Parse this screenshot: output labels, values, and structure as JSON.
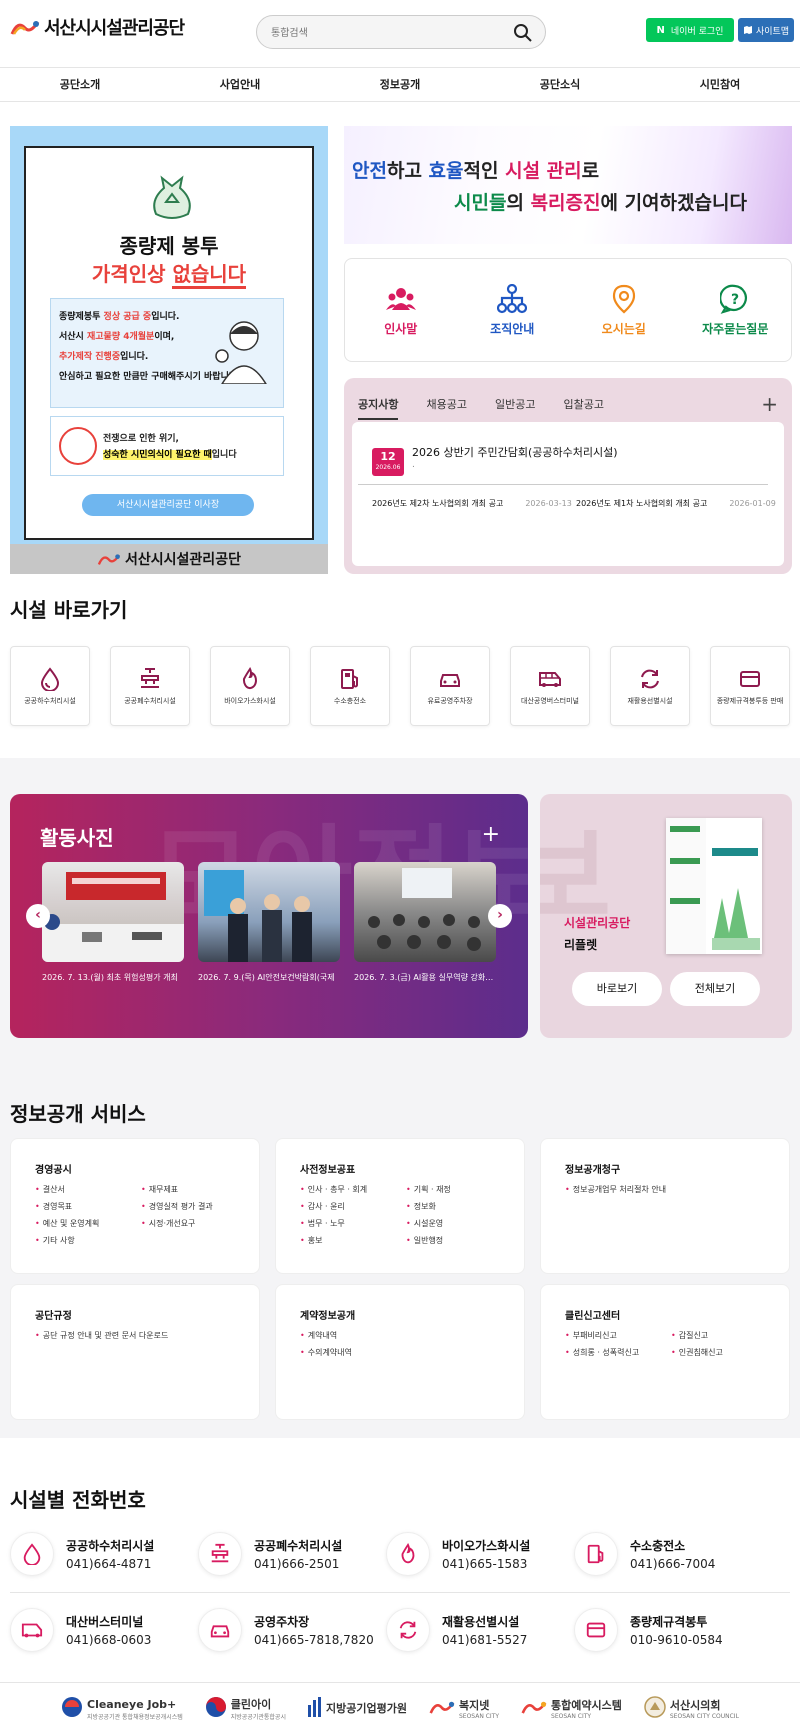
{
  "header": {
    "logo_text": "서산시시설관리공단",
    "search_placeholder": "통합검색",
    "naver_login": "네이버 로그인",
    "naver_n": "N",
    "sitemap": "사이트맵"
  },
  "gnb": [
    "공단소개",
    "사업안내",
    "정보공개",
    "공단소식",
    "시민참여"
  ],
  "poster": {
    "title": "종량제 봉투",
    "subtitle_a": "가격인상 ",
    "subtitle_b": "없습니다",
    "line1_a": "종량제봉투 ",
    "line1_b": "정상 공급 중",
    "line1_c": "입니다.",
    "line2_a": "서산시 ",
    "line2_b": "재고물량 4개월분",
    "line2_c": "이며,",
    "line3_a": "추가제작 진행중",
    "line3_b": "입니다.",
    "line4": "안심하고 필요한 만큼만 구매해주시기 바랍니다.",
    "quote1": "전쟁으로 인한 위기,",
    "quote2_a": "성숙한 시민의식이 필요한 때",
    "quote2_b": "입니다",
    "signature": "서산시시설관리공단 이사장",
    "footer_logo": "서산시시설관리공단"
  },
  "slogan": {
    "w1": "안전",
    "w2": "하고 ",
    "w3": "효율",
    "w4": "적인 ",
    "w5": "시설 관리",
    "w6": "로",
    "w7": "시민들",
    "w8": "의 ",
    "w9": "복리증진",
    "w10": "에 기여하겠습니다"
  },
  "quick_menu": [
    {
      "label": "인사말",
      "icon": "people-icon",
      "color": "#d81b60"
    },
    {
      "label": "조직안내",
      "icon": "org-chart-icon",
      "color": "#1f57c3"
    },
    {
      "label": "오시는길",
      "icon": "location-pin-icon",
      "color": "#f08a1c"
    },
    {
      "label": "자주묻는질문",
      "icon": "question-icon",
      "color": "#0c8a4a"
    }
  ],
  "notice": {
    "tabs": [
      "공지사항",
      "채용공고",
      "일반공고",
      "입찰공고"
    ],
    "plus": "+",
    "featured": {
      "day": "12",
      "date": "2026.06",
      "title": "2026 상반기 주민간담회(공공하수처리시설)",
      "dot": "."
    },
    "rows": [
      {
        "title": "2026년도 제2차 노사협의회 개최 공고",
        "date": "2026-03-13"
      },
      {
        "title": "2026년도 제1차 노사협의회 개최 공고",
        "date": "2026-01-09"
      }
    ]
  },
  "facility_shortcut": {
    "title": "시설 바로가기",
    "items": [
      {
        "label": "공공하수처리시설",
        "icon": "water-drop-icon"
      },
      {
        "label": "공공폐수처리시설",
        "icon": "faucet-icon"
      },
      {
        "label": "바이오가스화시설",
        "icon": "flame-icon"
      },
      {
        "label": "수소충전소",
        "icon": "fuel-pump-icon"
      },
      {
        "label": "유료공영주차장",
        "icon": "car-icon"
      },
      {
        "label": "대산공영버스터미널",
        "icon": "bus-icon"
      },
      {
        "label": "재활용선별시설",
        "icon": "recycle-icon"
      },
      {
        "label": "종량제규격봉투등 판매",
        "icon": "card-icon"
      }
    ]
  },
  "activity": {
    "title": "활동사진",
    "plus": "+",
    "bg_text": "모아정보",
    "prev": "‹",
    "next": "›",
    "photos": [
      {
        "caption": "2026. 7. 13.(월) 최초 위험성평가 개최"
      },
      {
        "caption": "2026. 7. 9.(목) AI안전보건박람회(국제"
      },
      {
        "caption": "2026. 7. 3.(금) AI활용 실무역량 강화교육"
      }
    ]
  },
  "leaflet": {
    "line1": "시설관리공단",
    "line2": "리플렛",
    "btn_view": "바로보기",
    "btn_all": "전체보기",
    "book_title": "서산시 시설관리공단"
  },
  "info_service": {
    "title": "정보공개 서비스",
    "cards": [
      {
        "title": "경영공시",
        "items": [
          "결산서",
          "재무제표",
          "경영목표",
          "경영실적 평가 결과",
          "예산 및 운영계획",
          "시정·개선요구",
          "기타 사항"
        ]
      },
      {
        "title": "사전정보공표",
        "items": [
          "인사 · 총무 · 회계",
          "기획 · 재정",
          "감사 · 윤리",
          "정보화",
          "법무 · 노무",
          "시설운영",
          "홍보",
          "일반행정"
        ]
      },
      {
        "title": "정보공개청구",
        "items": [
          "정보공개업무 처리절차 안내"
        ]
      },
      {
        "title": "공단규정",
        "items": [
          "공단 규정 안내 및 관련 문서 다운로드"
        ]
      },
      {
        "title": "계약정보공개",
        "items": [
          "계약내역",
          "수의계약내역"
        ]
      },
      {
        "title": "클린신고센터",
        "items": [
          "부패비리신고",
          "갑질신고",
          "성희롱 · 성폭력신고",
          "인권침해신고"
        ]
      }
    ]
  },
  "phones": {
    "title": "시설별 전화번호",
    "items": [
      {
        "name": "공공하수처리시설",
        "tel": "041)664-4871",
        "icon": "water-drop-icon"
      },
      {
        "name": "공공폐수처리시설",
        "tel": "041)666-2501",
        "icon": "faucet-icon"
      },
      {
        "name": "바이오가스화시설",
        "tel": "041)665-1583",
        "icon": "flame-icon"
      },
      {
        "name": "수소충전소",
        "tel": "041)666-7004",
        "icon": "fuel-pump-icon"
      },
      {
        "name": "대산버스터미널",
        "tel": "041)668-0603",
        "icon": "bus-icon"
      },
      {
        "name": "공영주차장",
        "tel": "041)665-7818,7820",
        "icon": "car-icon"
      },
      {
        "name": "재활용선별시설",
        "tel": "041)681-5527",
        "icon": "recycle-icon"
      },
      {
        "name": "종량제규격봉투",
        "tel": "010-9610-0584",
        "icon": "card-icon"
      }
    ]
  },
  "footer_links": [
    {
      "name": "Cleaneye Job+",
      "sub": "지방공공기관 통합채용정보공개시스템"
    },
    {
      "name": "클린아이",
      "sub": "지방공공기관통합공시"
    },
    {
      "name": "지방공기업평가원",
      "sub": ""
    },
    {
      "name": "복지넷",
      "sub": "SEOSAN CITY"
    },
    {
      "name": "통합예약시스템",
      "sub": "SEOSAN CITY"
    },
    {
      "name": "서산시의회",
      "sub": "SEOSAN CITY COUNCIL"
    }
  ],
  "colors": {
    "brand": "#d81b60",
    "naver": "#03c75a",
    "sitemap": "#2c6fb7"
  }
}
